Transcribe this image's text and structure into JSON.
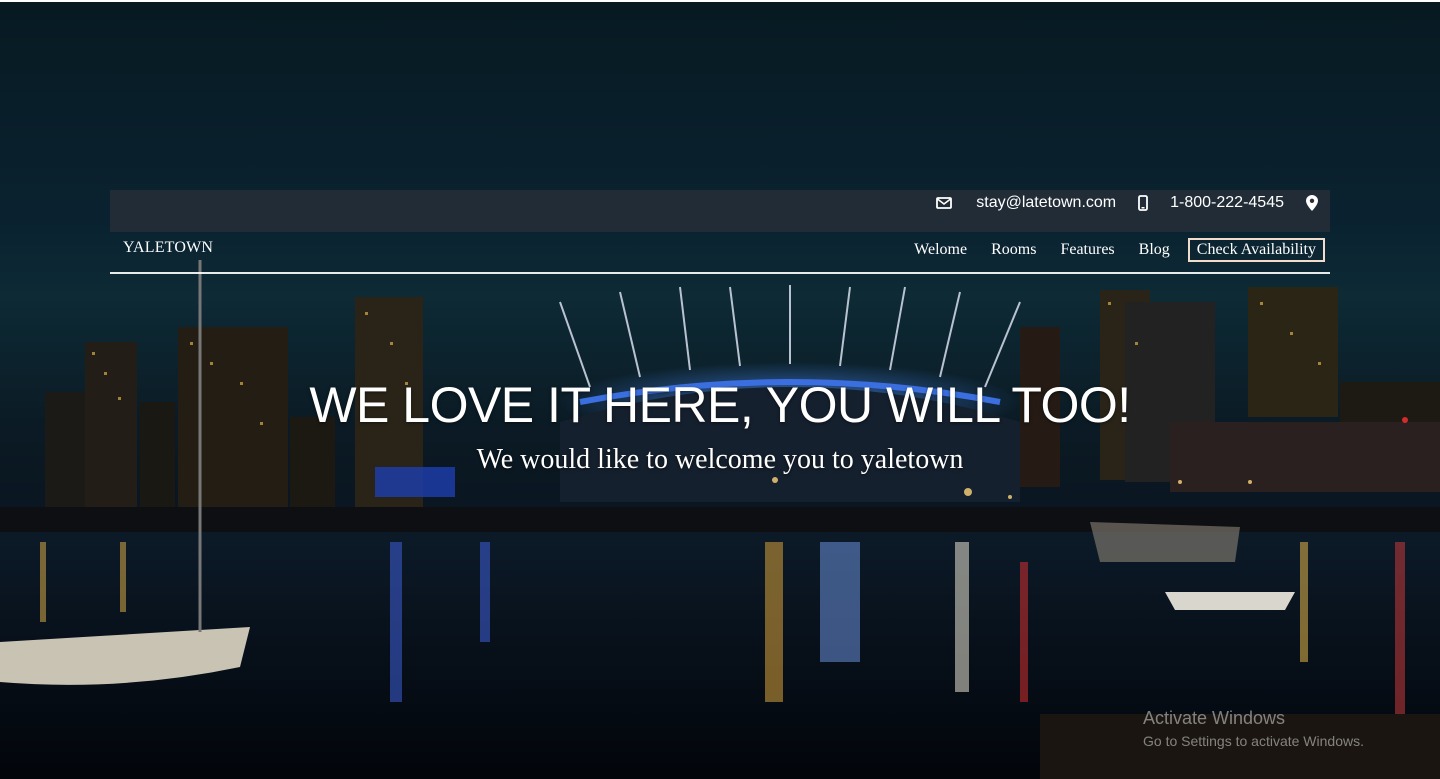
{
  "topbar": {
    "email": "stay@latetown.com",
    "phone": "1-800-222-4545",
    "email_icon": "envelope-icon",
    "phone_icon": "mobile-phone-icon",
    "location_icon": "map-marker-icon"
  },
  "nav": {
    "brand": "YALETOWN",
    "links": [
      "Welome",
      "Rooms",
      "Features",
      "Blog"
    ],
    "cta": "Check Availability"
  },
  "hero": {
    "headline": "WE LOVE IT HERE, YOU WILL TOO!",
    "subheadline": "We would like to welcome you to yaletown"
  },
  "watermark": {
    "title": "Activate Windows",
    "subtitle": "Go to Settings to activate Windows."
  },
  "colors": {
    "topbar_bg": "#2a303a",
    "cta_border": "#f3dccb",
    "text": "#ffffff"
  }
}
